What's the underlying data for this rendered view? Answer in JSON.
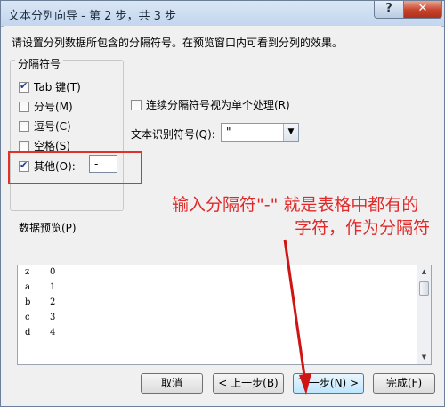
{
  "window": {
    "title": "文本分列向导 - 第 2 步，共 3 步",
    "help_label": "?",
    "close_label": "✕"
  },
  "instruction": "请设置分列数据所包含的分隔符号。在预览窗口内可看到分列的效果。",
  "delimiters": {
    "group_title": "分隔符号",
    "tab": {
      "label": "Tab 键(T)",
      "checked": true
    },
    "semicolon": {
      "label": "分号(M)",
      "checked": false
    },
    "comma": {
      "label": "逗号(C)",
      "checked": false
    },
    "space": {
      "label": "空格(S)",
      "checked": false
    },
    "other": {
      "label": "其他(O):",
      "checked": true,
      "value": "-"
    }
  },
  "options": {
    "consecutive_label": "连续分隔符号视为单个处理(R)",
    "consecutive_checked": false,
    "text_qualifier_label": "文本识别符号(Q):",
    "text_qualifier_value": "\""
  },
  "annotation": {
    "line1": "输入分隔符\"-\" 就是表格中都有的",
    "line2": "字符，作为分隔符"
  },
  "preview": {
    "label": "数据预览(P)",
    "rows": [
      [
        "z",
        "0"
      ],
      [
        "a",
        "1"
      ],
      [
        "b",
        "2"
      ],
      [
        "c",
        "3"
      ],
      [
        "d",
        "4"
      ]
    ]
  },
  "buttons": {
    "cancel": "取消",
    "back": "< 上一步(B)",
    "next": "下一步(N) >",
    "finish": "完成(F)"
  },
  "colors": {
    "annotation": "#e02a2a",
    "highlight_box": "#e0312b"
  }
}
